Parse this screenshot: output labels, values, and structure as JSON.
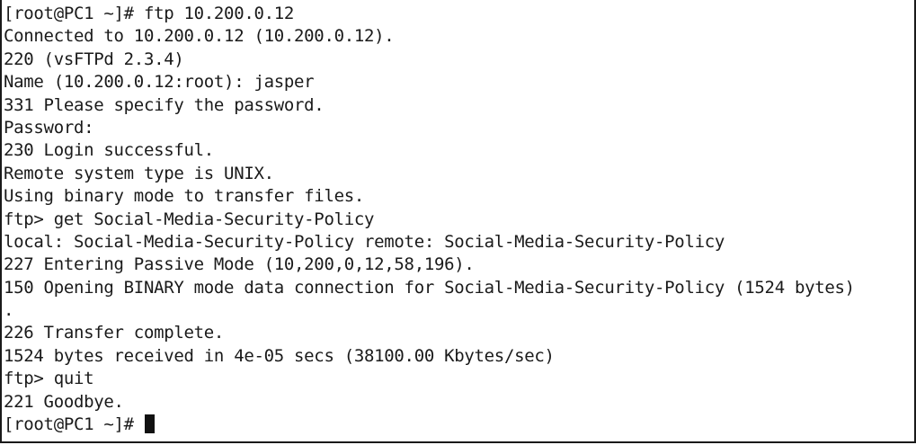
{
  "terminal": {
    "lines": [
      "[root@PC1 ~]# ftp 10.200.0.12",
      "Connected to 10.200.0.12 (10.200.0.12).",
      "220 (vsFTPd 2.3.4)",
      "Name (10.200.0.12:root): jasper",
      "331 Please specify the password.",
      "Password:",
      "230 Login successful.",
      "Remote system type is UNIX.",
      "Using binary mode to transfer files.",
      "ftp> get Social-Media-Security-Policy",
      "local: Social-Media-Security-Policy remote: Social-Media-Security-Policy",
      "227 Entering Passive Mode (10,200,0,12,58,196).",
      "150 Opening BINARY mode data connection for Social-Media-Security-Policy (1524 bytes)",
      ".",
      "226 Transfer complete.",
      "1524 bytes received in 4e-05 secs (38100.00 Kbytes/sec)",
      "ftp> quit",
      "221 Goodbye."
    ],
    "prompt": "[root@PC1 ~]# "
  }
}
